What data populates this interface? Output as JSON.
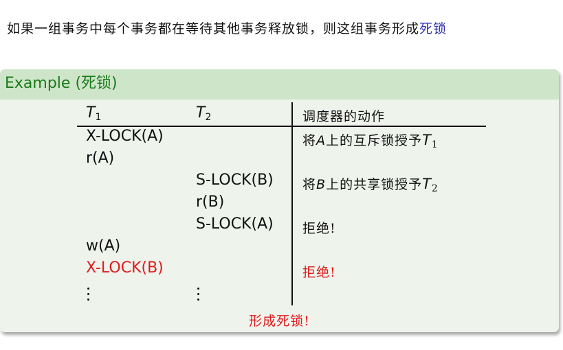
{
  "intro": {
    "text": "如果一组事务中每个事务都在等待其他事务释放锁，则这组事务形成",
    "term": "死锁"
  },
  "example": {
    "title_prefix": "Example (",
    "title_cn": "死锁",
    "title_suffix": ")",
    "headers": {
      "t1": "T",
      "t1_sub": "1",
      "t2": "T",
      "t2_sub": "2",
      "scheduler": "调度器的动作"
    },
    "rows": [
      {
        "t1": "X-LOCK(A)",
        "t2": "",
        "action": "将A上的互斥锁授予T1"
      },
      {
        "t1": "r(A)",
        "t2": "",
        "action": ""
      },
      {
        "t1": "",
        "t2": "S-LOCK(B)",
        "action": "将B上的共享锁授予T2"
      },
      {
        "t1": "",
        "t2": "r(B)",
        "action": ""
      },
      {
        "t1": "",
        "t2": "S-LOCK(A)",
        "action": "拒绝!"
      },
      {
        "t1": "w(A)",
        "t2": "",
        "action": ""
      },
      {
        "t1": "X-LOCK(B)",
        "t2": "",
        "action": "拒绝!"
      }
    ],
    "action_parts": {
      "row1_pre": "将",
      "row1_var": "A",
      "row1_mid": "上的互斥锁授予",
      "row1_T": "T",
      "row1_sub": "1",
      "row3_pre": "将",
      "row3_var": "B",
      "row3_mid": "上的共享锁授予",
      "row3_T": "T",
      "row3_sub": "2"
    },
    "footer": "形成死锁!",
    "colors": {
      "accent_red": "#e01b1b",
      "title_green": "#1a7a1a",
      "term_blue": "#3333b3"
    }
  }
}
